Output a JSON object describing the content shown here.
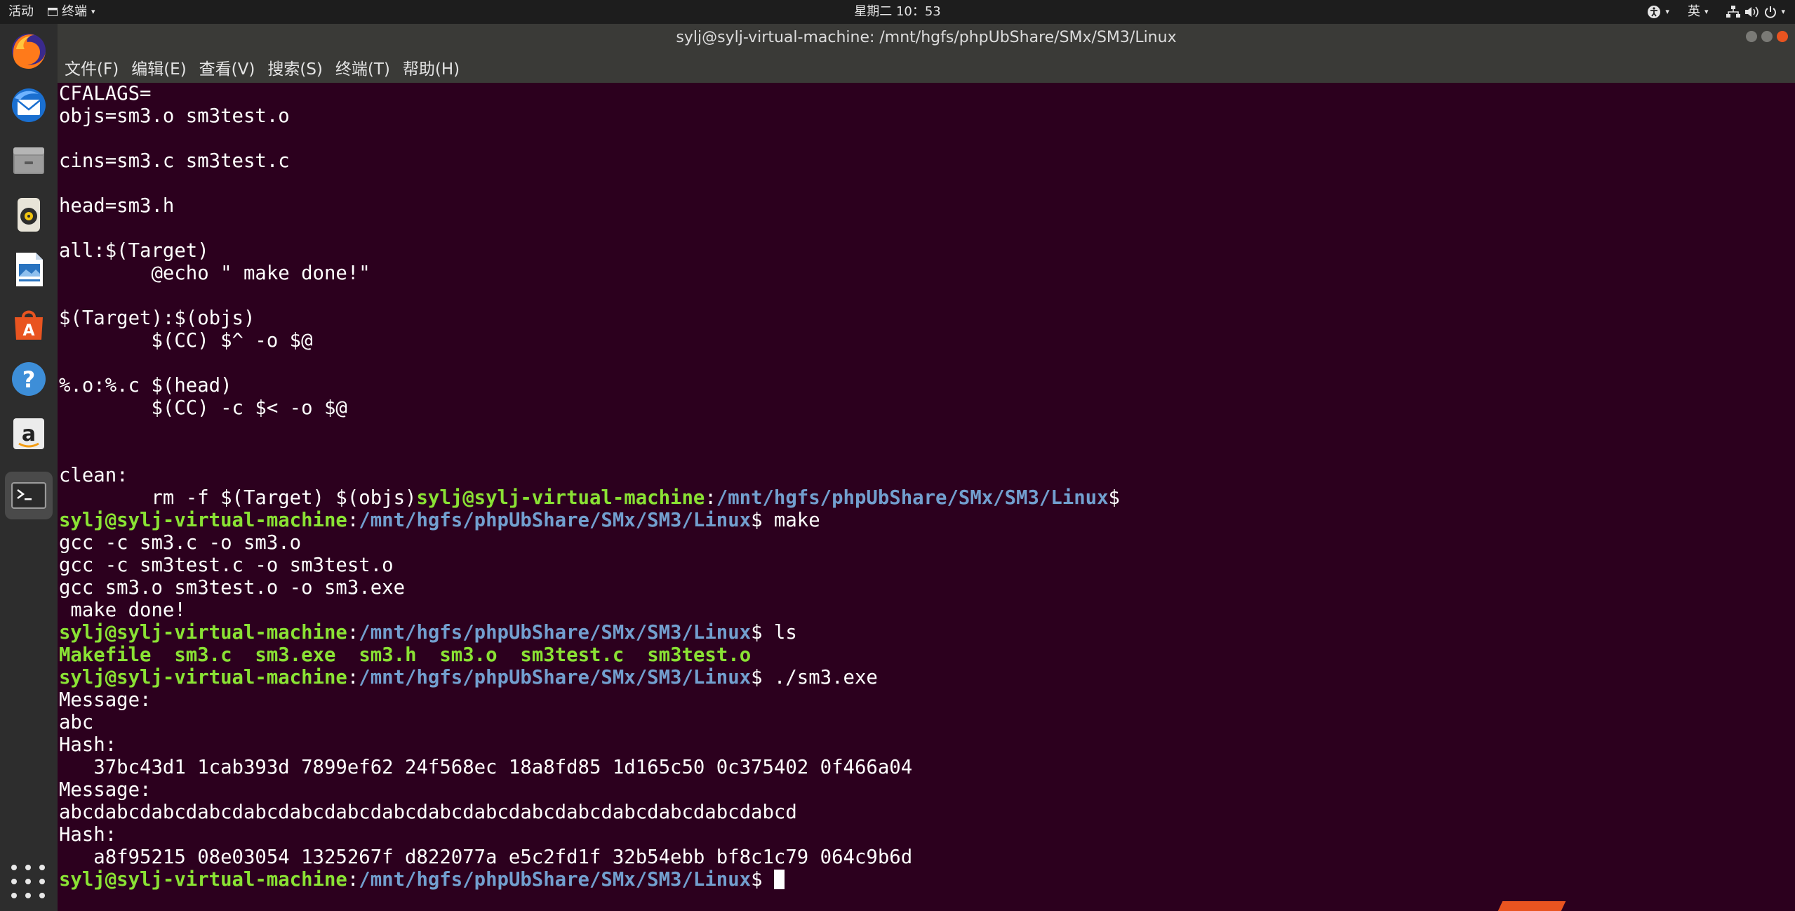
{
  "topbar": {
    "activities": "活动",
    "app_name": "终端",
    "clock": "星期二 10：53",
    "input_method": "英"
  },
  "dock": {
    "items": [
      {
        "name": "firefox-icon"
      },
      {
        "name": "thunderbird-icon"
      },
      {
        "name": "files-icon"
      },
      {
        "name": "rhythmbox-icon"
      },
      {
        "name": "libreoffice-writer-icon"
      },
      {
        "name": "software-center-icon"
      },
      {
        "name": "help-icon"
      },
      {
        "name": "amazon-icon"
      },
      {
        "name": "terminal-icon"
      }
    ]
  },
  "window": {
    "title": "sylj@sylj-virtual-machine: /mnt/hgfs/phpUbShare/SMx/SM3/Linux"
  },
  "menu": {
    "file": "文件(F)",
    "edit": "编辑(E)",
    "view": "查看(V)",
    "search": "搜索(S)",
    "terminal": "终端(T)",
    "help": "帮助(H)"
  },
  "prompt": {
    "user": "sylj@sylj-virtual-machine",
    "path": "/mnt/hgfs/phpUbShare/SMx/SM3/Linux",
    "symbol": "$"
  },
  "terminal": {
    "l01": "CFALAGS=",
    "l02": "objs=sm3.o sm3test.o",
    "l03": "",
    "l04": "cins=sm3.c sm3test.c",
    "l05": "",
    "l06": "head=sm3.h",
    "l07": "",
    "l08": "all:$(Target)",
    "l09": "        @echo \" make done!\"",
    "l10": "",
    "l11": "$(Target):$(objs)",
    "l12": "        $(CC) $^ -o $@",
    "l13": "",
    "l14": "%.o:%.c $(head)",
    "l15": "        $(CC) -c $< -o $@",
    "l16": "",
    "l17": "",
    "l18": "clean:",
    "l19_pre": "        rm -f $(Target) $(objs)",
    "cmd_make": " make",
    "l21": "gcc -c sm3.c -o sm3.o",
    "l22": "gcc -c sm3test.c -o sm3test.o",
    "l23": "gcc sm3.o sm3test.o -o sm3.exe",
    "l24": " make done!",
    "cmd_ls": " ls",
    "ls_files": [
      "Makefile",
      "sm3.c",
      "sm3.exe",
      "sm3.h",
      "sm3.o",
      "sm3test.c",
      "sm3test.o"
    ],
    "cmd_run": " ./sm3.exe",
    "l28": "Message:",
    "l29": "abc",
    "l30": "Hash:",
    "l31": "   37bc43d1 1cab393d 7899ef62 24f568ec 18a8fd85 1d165c50 0c375402 0f466a04",
    "l32": "Message:",
    "l33": "abcdabcdabcdabcdabcdabcdabcdabcdabcdabcdabcdabcdabcdabcdabcdabcd",
    "l34": "Hash:",
    "l35": "   a8f95215 08e03054 1325267f d822077a e5c2fd1f 32b54ebb bf8c1c79 064c9b6d"
  }
}
